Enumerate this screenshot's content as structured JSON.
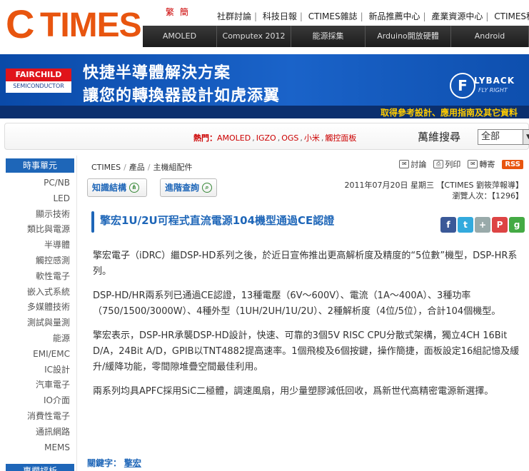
{
  "header": {
    "logo_c": "C",
    "logo_text": "TIMES",
    "lang": [
      "繁",
      "簡"
    ],
    "top_links": [
      "社群討論",
      "科技日報",
      "CTIMES雜誌",
      "新品推薦中心",
      "產業資源中心",
      "CTIMES科"
    ],
    "nav": [
      "AMOLED",
      "Computex 2012",
      "能源採集",
      "Arduino開放硬體",
      "Android"
    ]
  },
  "banner": {
    "brand_top": "FAIRCHILD",
    "brand_bottom": "SEMICONDUCTOR",
    "line1": "快捷半導體解決方案",
    "line2": "讓您的轉換器設計如虎添翼",
    "fly_letter": "F",
    "fly_title": "LYBACK",
    "fly_sub": "FLY RIGHT",
    "cta": "取得參考設計、應用指南及其它資料"
  },
  "search": {
    "hot_label": "熱門：",
    "hot_keywords": [
      "AMOLED",
      "IGZO",
      "OGS",
      "小米",
      "觸控面板"
    ],
    "label": "萬維搜尋",
    "select_value": "全部"
  },
  "sidebar": {
    "title": "時事單元",
    "items": [
      "PC/NB",
      "LED",
      "顯示技術",
      "類比與電源",
      "半導體",
      "觸控感測",
      "軟性電子",
      "嵌入式系統",
      "多媒體技術",
      "測試與量測",
      "能源",
      "EMI/EMC",
      "IC設計",
      "汽車電子",
      "IO介面",
      "消費性電子",
      "通訊網路",
      "MEMS"
    ],
    "title2": "專欄評析"
  },
  "main": {
    "breadcrumb": [
      "CTIMES",
      "產品",
      "主機組配件"
    ],
    "tools": [
      "討論",
      "列印",
      "轉寄"
    ],
    "rss": "RSS",
    "btn_knowledge": "知識結構",
    "btn_advanced": "進階查詢",
    "meta_date": "2011年07月20日 星期三 【CTIMES 劉筱萍報導】",
    "meta_views": "瀏覽人次：【1296】",
    "title": "擎宏1U/2U可程式直流電源104機型通過CE認證",
    "share": [
      "f",
      "t",
      "+",
      "P",
      "g"
    ],
    "paragraphs": [
      "擎宏電子（iDRC）繼DSP-HD系列之後，於近日宣佈推出更高解析度及精度的“5位數”機型，DSP-HR系列。",
      "DSP-HD/HR兩系列已通過CE認證，13種電壓（6V～600V）、電流（1A～400A）、3種功率（750/1500/3000W）、4種外型（1UH/2UH/1U/2U）、2種解析度（4位/5位），合計104個機型。",
      "擎宏表示，DSP-HR承襲DSP-HD設計，快速、可靠的3個5V RISC CPU分散式架構，獨立4CH 16Bit D/A，24Bit A/D，GPIB以TNT4882提高速率。1個飛梭及6個按鍵，操作簡捷，面板設定16組記憶及緩升/緩降功能，零間隙堆疊空間最佳利用。",
      "兩系列均具APFC採用SiC二極體，調速風扇，用少量塑膠減低回收，爲新世代高精密電源新選擇。"
    ],
    "keywords_label": "關鍵字：",
    "keyword": "擎宏"
  }
}
